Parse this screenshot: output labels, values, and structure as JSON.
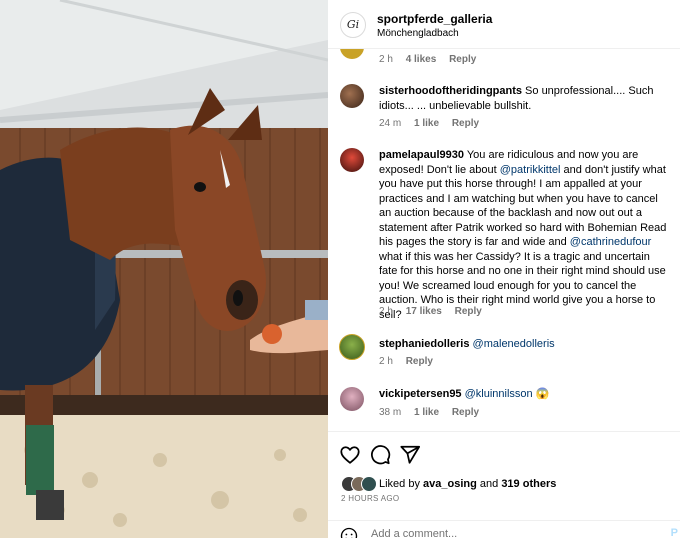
{
  "post": {
    "username": "sportpferde_galleria",
    "location": "Mönchengladbach",
    "avatar_monogram": "Gi"
  },
  "comments": [
    {
      "username": "",
      "text": "",
      "time": "2 h",
      "likes": "4 likes",
      "reply": "Reply",
      "avatar_color": "#c9a227"
    },
    {
      "username": "sisterhoodoftheridingpants",
      "text": " So unprofessional.... Such idiots... ... unbelievable bullshit.",
      "time": "24 m",
      "likes": "1 like",
      "reply": "Reply",
      "avatar_color": "#5a3b2a"
    },
    {
      "username": "pamelapaul9930",
      "text_parts": [
        {
          "t": " You are ridiculous and now you are exposed! Don't lie about "
        },
        {
          "m": "@patrikkittel"
        },
        {
          "t": " and don't justify what you have put this horse through! I am appalled at your practices and I am watching but when you have to cancel an auction because of the backlash and now out out a statement after Patrik worked so hard with Bohemian Read his pages the story is far and wide and "
        },
        {
          "m": "@cathrinedufour"
        },
        {
          "t": " what if this was her Cassidy? It is a tragic and uncertain fate for this horse and no one in their right mind should use you! We screamed loud enough for you to cancel the auction. Who is their right mind world give you a horse to sell?"
        }
      ],
      "time": "2 h",
      "likes": "17 likes",
      "reply": "Reply",
      "avatar_color": "#b3261e"
    },
    {
      "username": "stephaniedolleris",
      "mention": "@malenedolleris",
      "time": "2 h",
      "reply": "Reply",
      "avatar_color": "#6b8e23"
    },
    {
      "username": "vickipetersen95",
      "mention": "@kluinnilsson",
      "emoji": "😱",
      "time": "38 m",
      "likes": "1 like",
      "reply": "Reply",
      "avatar_color": "#c48f9b"
    }
  ],
  "actions": {
    "liked_prefix": "Liked by ",
    "liked_user": "ava_osing",
    "liked_mid": " and ",
    "liked_others": "319 others",
    "time_ago": "2 HOURS AGO",
    "add_comment_placeholder": "Add a comment...",
    "post_label": "P",
    "like_avatar_colors": [
      "#3a3a3a",
      "#7a6a5a",
      "#2f4f4f"
    ]
  },
  "icons": {
    "like": "heart-icon",
    "comment": "comment-bubble-icon",
    "share": "paper-plane-icon",
    "emoji": "smiley-icon"
  }
}
